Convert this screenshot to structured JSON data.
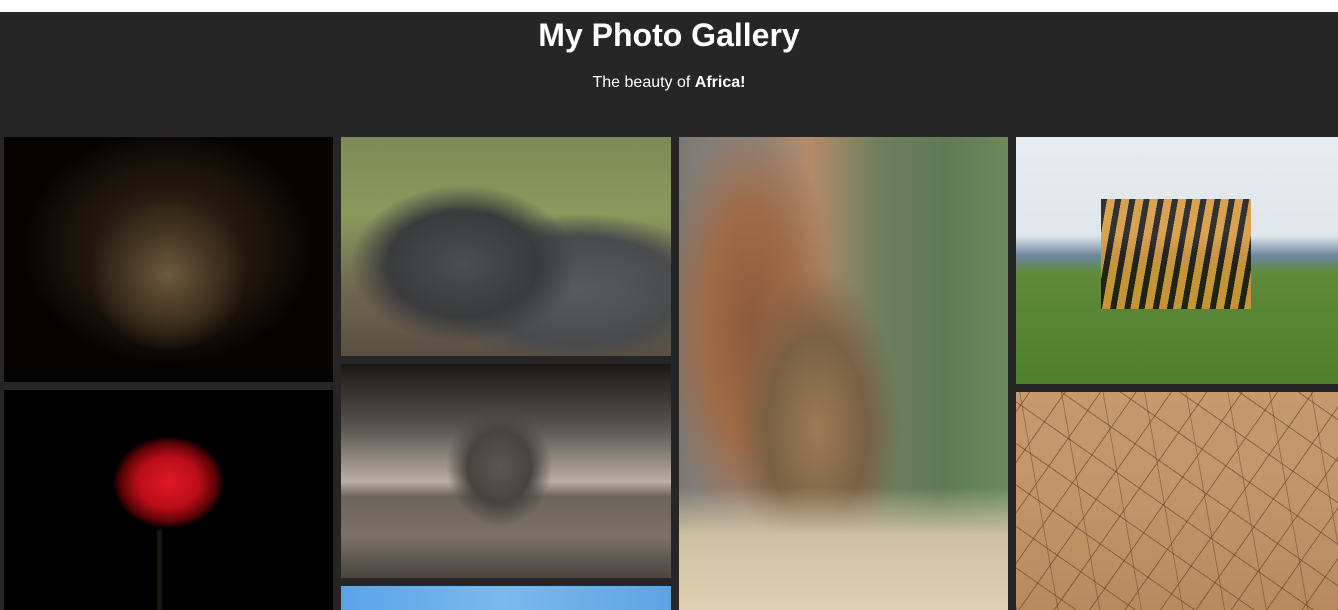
{
  "header": {
    "title": "My Photo Gallery",
    "subtitle_prefix": "The beauty of ",
    "subtitle_emphasis": "Africa!"
  },
  "gallery": {
    "photos": [
      {
        "subject": "lion"
      },
      {
        "subject": "buffalo"
      },
      {
        "subject": "man in hut"
      },
      {
        "subject": "zebra"
      },
      {
        "subject": "red rose"
      },
      {
        "subject": "elephant"
      },
      {
        "subject": "cracked earth"
      },
      {
        "subject": "blue sky"
      }
    ]
  },
  "colors": {
    "background": "#262626",
    "text": "#ffffff",
    "top_strip": "#ffffff"
  }
}
